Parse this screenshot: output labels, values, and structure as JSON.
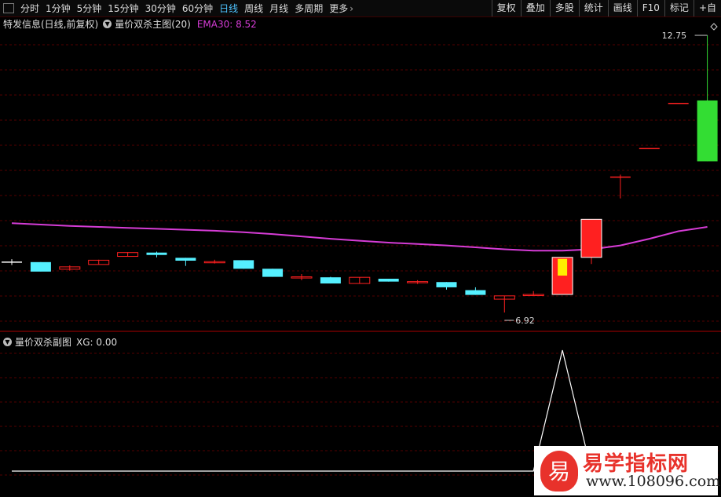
{
  "toolbar": {
    "periods": [
      "分时",
      "1分钟",
      "5分钟",
      "15分钟",
      "30分钟",
      "60分钟",
      "日线",
      "周线",
      "月线",
      "多周期",
      "更多"
    ],
    "active_period": "日线",
    "right_buttons": [
      "复权",
      "叠加",
      "多股",
      "统计",
      "画线",
      "F10",
      "标记",
      "+自"
    ]
  },
  "main_panel": {
    "stock_name": "特发信息(日线,前复权)",
    "indicator_name": "量价双杀主图(20)",
    "ema_label": "EMA30: 8.52",
    "ema_color": "#d63cd6",
    "high_label": "12.75",
    "low_label": "6.92"
  },
  "sub_panel": {
    "indicator_name": "量价双杀副图",
    "xg_label": "XG: 0.00"
  },
  "watermark": {
    "logo_char": "易",
    "title": "易学指标网",
    "url": "www.108096.com"
  },
  "colors": {
    "up": "#ff2020",
    "down": "#55f0ff",
    "big_down": "#33dd33",
    "highlight": "#ffee00",
    "grid": "#550000"
  },
  "chart_data": {
    "type": "candlestick",
    "candles": [
      {
        "open": 7.98,
        "close": 7.98,
        "high": 8.04,
        "low": 7.92
      },
      {
        "open": 7.98,
        "close": 7.78,
        "high": 7.98,
        "low": 7.78
      },
      {
        "open": 7.83,
        "close": 7.88,
        "high": 7.91,
        "low": 7.8
      },
      {
        "open": 7.93,
        "close": 8.02,
        "high": 8.03,
        "low": 7.93
      },
      {
        "open": 8.1,
        "close": 8.18,
        "high": 8.19,
        "low": 8.1
      },
      {
        "open": 8.18,
        "close": 8.13,
        "high": 8.2,
        "low": 8.08
      },
      {
        "open": 8.07,
        "close": 8.01,
        "high": 8.07,
        "low": 7.9
      },
      {
        "open": 7.97,
        "close": 7.99,
        "high": 8.03,
        "low": 7.95
      },
      {
        "open": 8.02,
        "close": 7.84,
        "high": 8.02,
        "low": 7.84
      },
      {
        "open": 7.84,
        "close": 7.67,
        "high": 7.84,
        "low": 7.67
      },
      {
        "open": 7.66,
        "close": 7.67,
        "high": 7.73,
        "low": 7.6
      },
      {
        "open": 7.66,
        "close": 7.53,
        "high": 7.67,
        "low": 7.53
      },
      {
        "open": 7.53,
        "close": 7.66,
        "high": 7.66,
        "low": 7.53
      },
      {
        "open": 7.63,
        "close": 7.57,
        "high": 7.63,
        "low": 7.57
      },
      {
        "open": 7.56,
        "close": 7.57,
        "high": 7.6,
        "low": 7.52
      },
      {
        "open": 7.56,
        "close": 7.45,
        "high": 7.56,
        "low": 7.4
      },
      {
        "open": 7.39,
        "close": 7.29,
        "high": 7.45,
        "low": 7.29
      },
      {
        "open": 7.2,
        "close": 7.27,
        "high": 7.27,
        "low": 6.92
      },
      {
        "open": 7.28,
        "close": 7.3,
        "high": 7.37,
        "low": 7.28
      },
      {
        "open": 7.3,
        "close": 8.08,
        "high": 8.08,
        "low": 7.3
      },
      {
        "open": 8.08,
        "close": 8.88,
        "high": 8.88,
        "low": 7.94
      },
      {
        "open": 9.78,
        "close": 9.78,
        "high": 9.82,
        "low": 9.32
      },
      {
        "open": 10.38,
        "close": 10.38,
        "high": 10.38,
        "low": 10.38
      },
      {
        "open": 11.33,
        "close": 11.33,
        "high": 11.33,
        "low": 11.33
      },
      {
        "open": 11.38,
        "close": 10.1,
        "high": 12.75,
        "low": 10.1
      }
    ],
    "ema30": [
      8.8,
      8.77,
      8.74,
      8.72,
      8.7,
      8.68,
      8.66,
      8.64,
      8.61,
      8.57,
      8.52,
      8.47,
      8.43,
      8.39,
      8.36,
      8.33,
      8.29,
      8.25,
      8.22,
      8.22,
      8.25,
      8.33,
      8.47,
      8.63,
      8.72
    ],
    "xg": [
      0,
      0,
      0,
      0,
      0,
      0,
      0,
      0,
      0,
      0,
      0,
      0,
      0,
      0,
      0,
      0,
      0,
      0,
      0,
      1,
      0,
      0,
      0,
      0,
      0
    ]
  }
}
